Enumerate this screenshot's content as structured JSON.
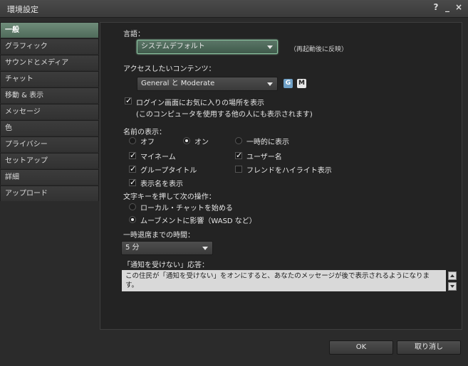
{
  "window": {
    "title": "環境設定",
    "help": "?",
    "minimize": "_",
    "close": "×"
  },
  "sidebar": {
    "items": [
      {
        "label": "一般",
        "active": true
      },
      {
        "label": "グラフィック"
      },
      {
        "label": "サウンドとメディア"
      },
      {
        "label": "チャット"
      },
      {
        "label": "移動 & 表示"
      },
      {
        "label": "メッセージ"
      },
      {
        "label": "色"
      },
      {
        "label": "プライバシー"
      },
      {
        "label": "セットアップ"
      },
      {
        "label": "詳細"
      },
      {
        "label": "アップロード"
      }
    ]
  },
  "general": {
    "language_label": "言語：",
    "language_value": "システムデフォルト",
    "language_note": "（再起動後に反映）",
    "content_label": "アクセスしたいコンテンツ：",
    "content_value": "General と Moderate",
    "content_badges": [
      "G",
      "M"
    ],
    "favorites_label": "ログイン画面にお気に入りの場所を表示",
    "favorites_note": "(このコンピュータを使用する他の人にも表示されます)",
    "favorites_checked": true,
    "names_label": "名前の表示：",
    "names_options": [
      "オフ",
      "オン",
      "一時的に表示"
    ],
    "names_selected": "オン",
    "my_name": "マイネーム",
    "user_name": "ユーザー名",
    "group_title": "グループタイトル",
    "highlight_friends": "フレンドをハイライト表示",
    "display_name": "表示名を表示",
    "my_name_checked": true,
    "user_name_checked": true,
    "group_title_checked": true,
    "highlight_friends_checked": false,
    "display_name_checked": true,
    "keys_label": "文字キーを押して次の操作：",
    "keys_options": [
      "ローカル・チャットを始める",
      "ムーブメントに影響（WASD など）"
    ],
    "keys_selected": "ムーブメントに影響（WASD など）",
    "away_label": "一時退席までの時間：",
    "away_value": "5 分",
    "busy_label": "「通知を受けない」応答：",
    "busy_text": "この住民が「通知を受けない」をオンにすると、あなたのメッセージが後で表示されるようになります。"
  },
  "footer": {
    "ok": "OK",
    "cancel": "取り消し"
  }
}
